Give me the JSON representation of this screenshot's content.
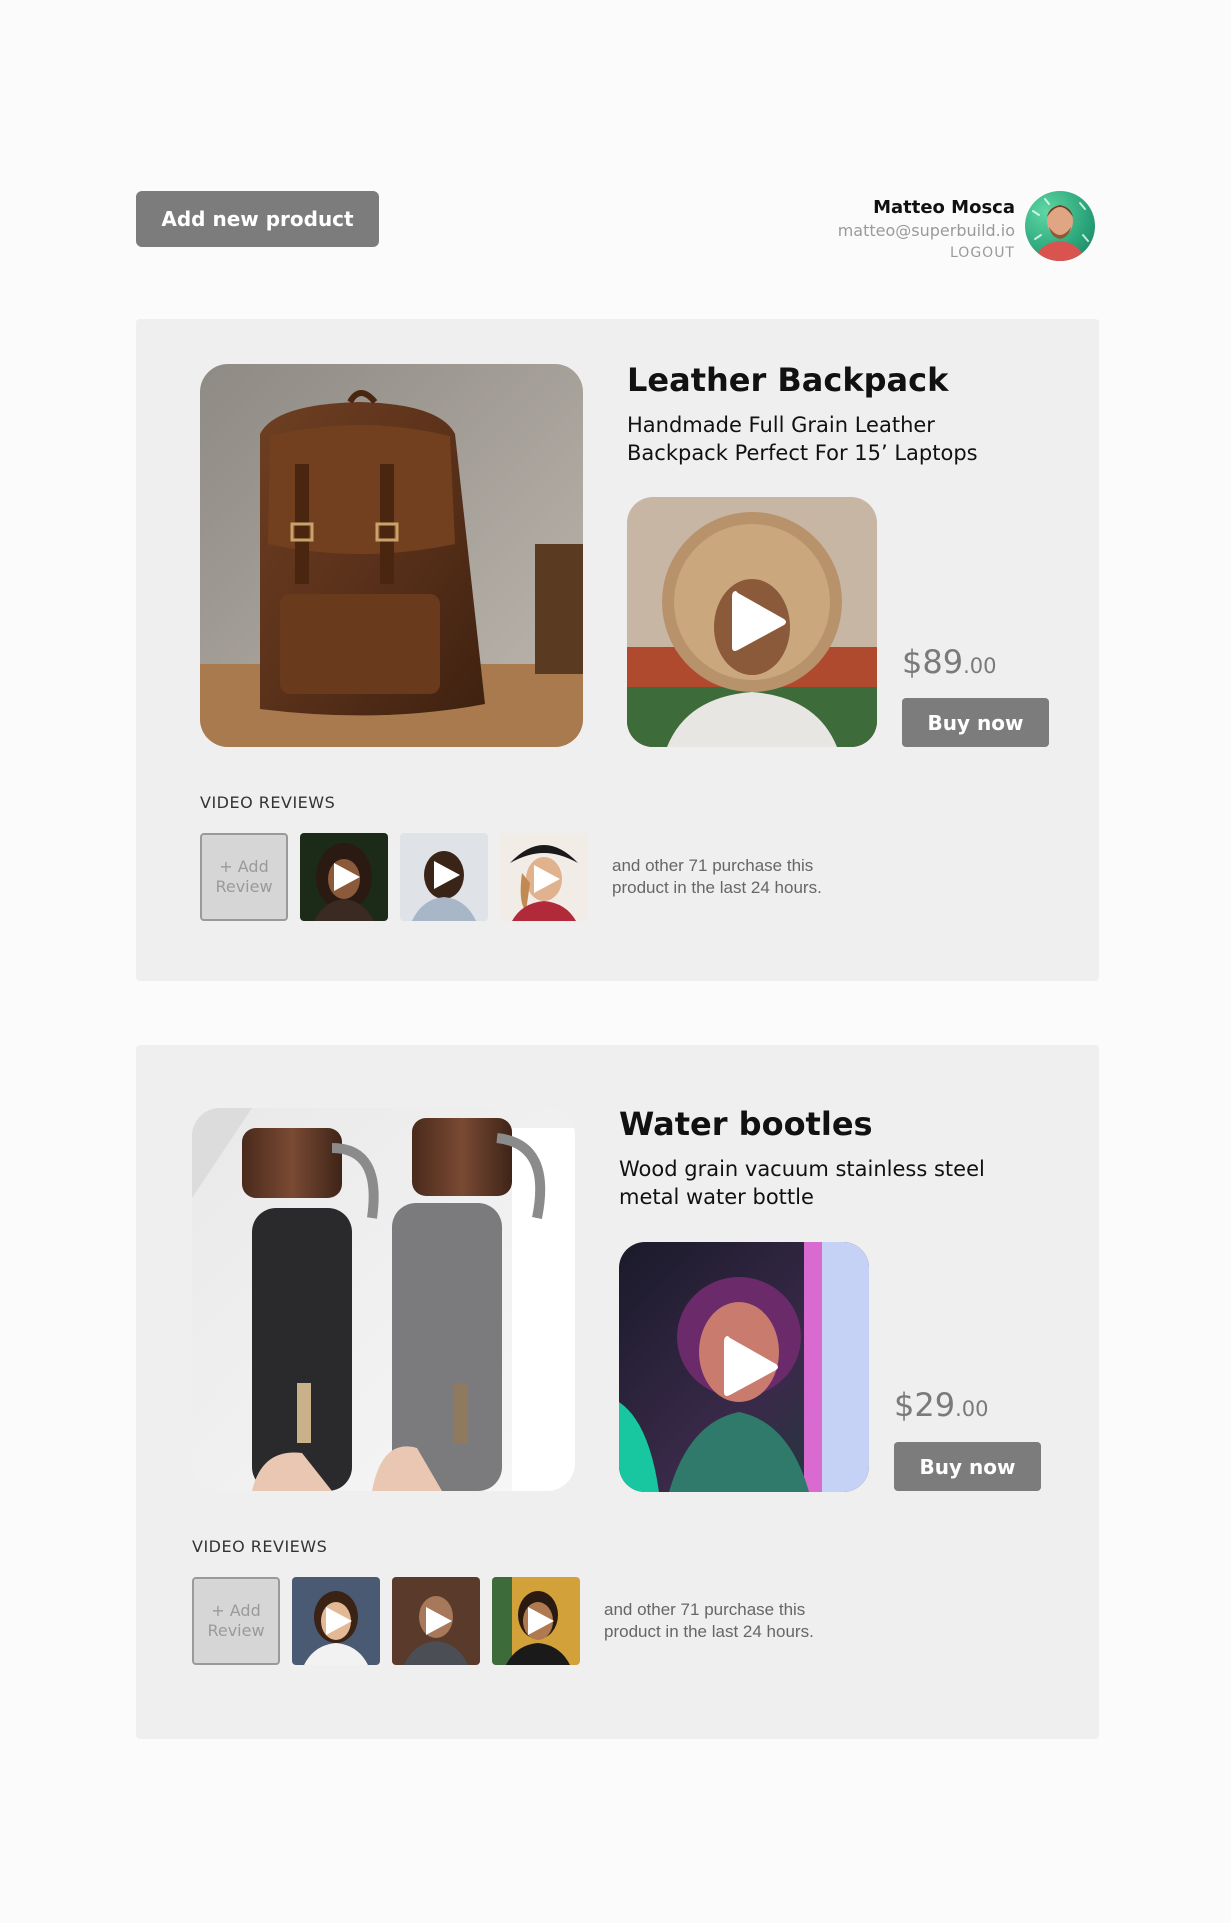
{
  "header": {
    "add_product_label": "Add new product",
    "user": {
      "name": "Matteo Mosca",
      "email": "matteo@superbuild.io",
      "logout_label": "LOGOUT"
    }
  },
  "products": [
    {
      "title": "Leather Backpack",
      "description": "Handmade Full Grain Leather Backpack Perfect For 15’ Laptops",
      "price_main": "$89",
      "price_cents": ".00",
      "buy_label": "Buy now",
      "reviews_heading": "VIDEO REVIEWS",
      "add_review_line1": "+ Add",
      "add_review_line2": "Review",
      "purchase_note": "and other 71 purchase this product in the last 24 hours."
    },
    {
      "title": "Water bootles",
      "description": "Wood grain vacuum stainless steel metal water bottle",
      "price_main": "$29",
      "price_cents": ".00",
      "buy_label": "Buy now",
      "reviews_heading": "VIDEO REVIEWS",
      "add_review_line1": "+ Add",
      "add_review_line2": "Review",
      "purchase_note": "and other 71 purchase this product in the last 24 hours."
    }
  ],
  "icons": {
    "play": "play-icon"
  },
  "colors": {
    "button_bg": "#7c7c7c",
    "card_bg": "#efefef",
    "price_text": "#7a7a7a"
  }
}
